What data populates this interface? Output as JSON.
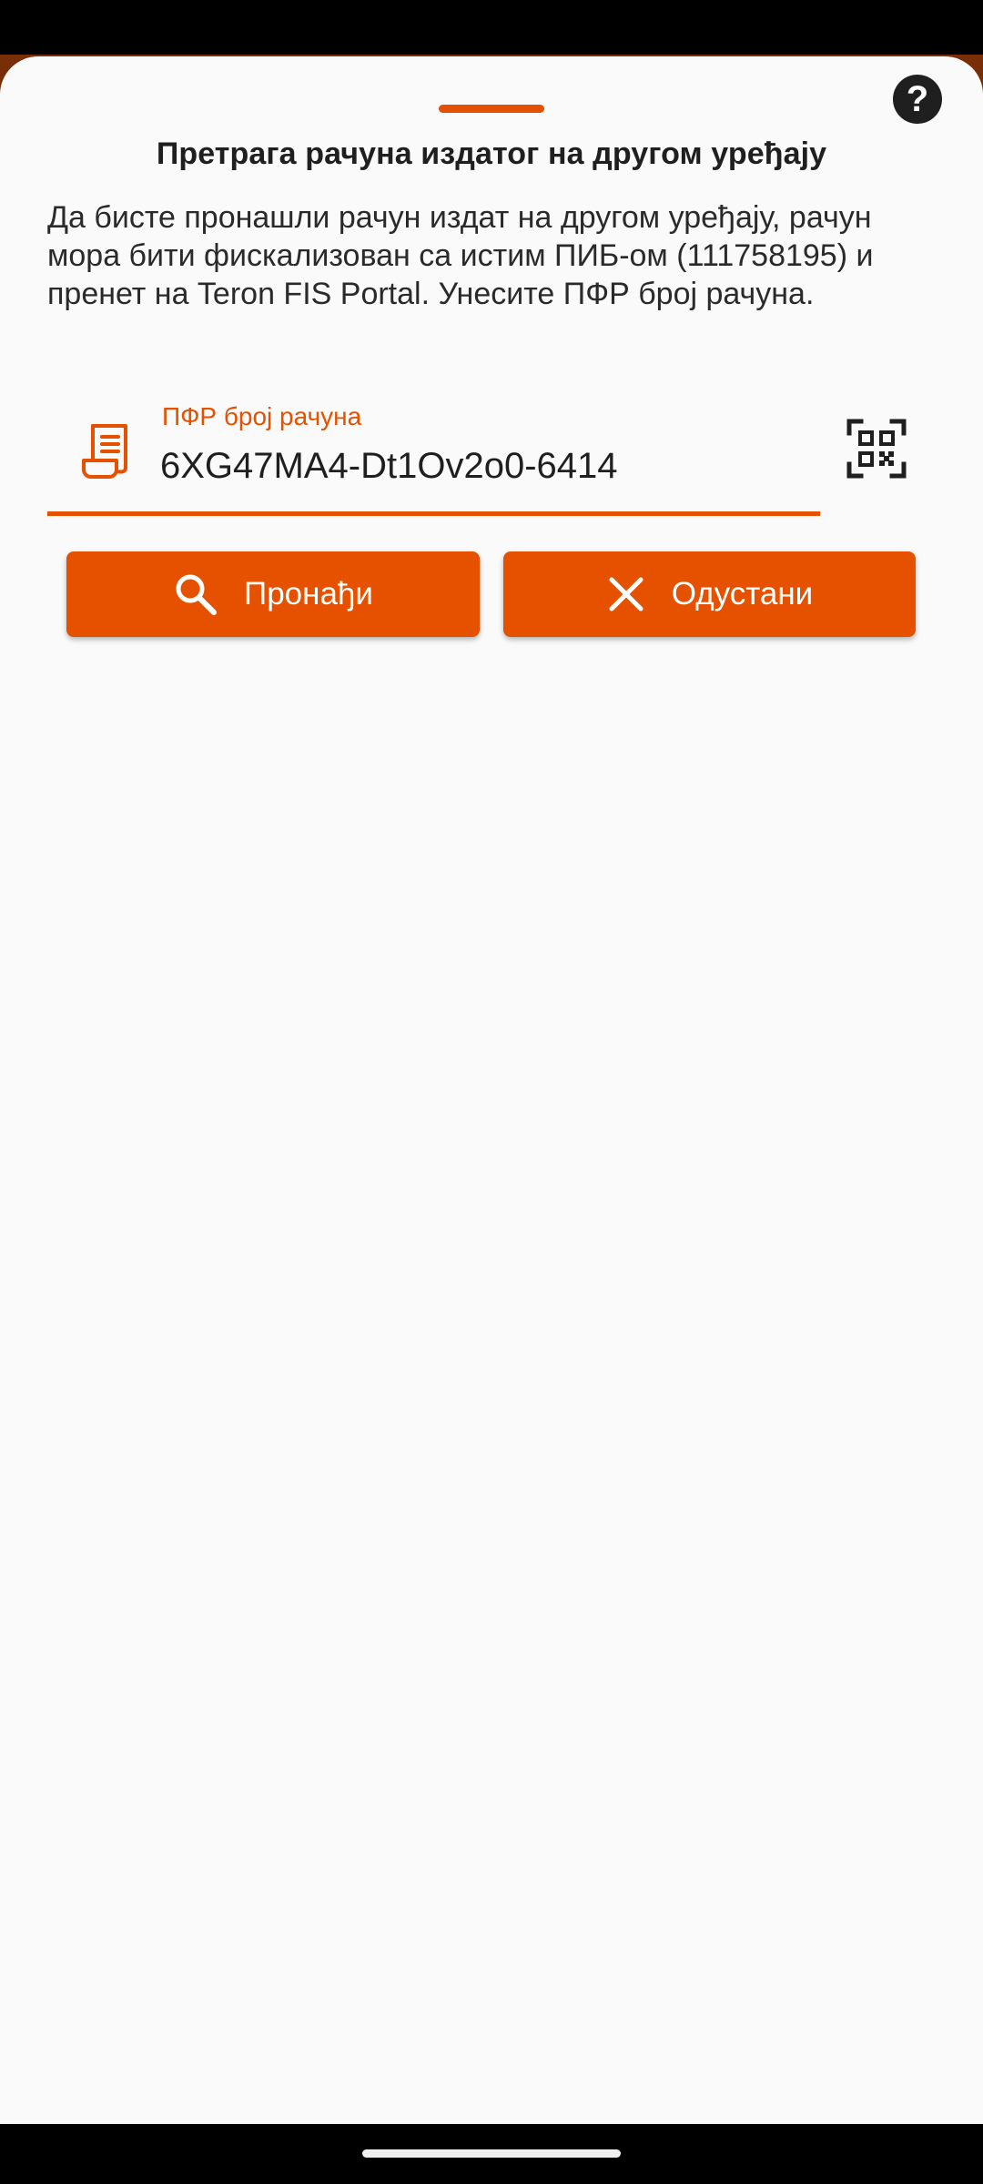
{
  "colors": {
    "accent": "#e65100",
    "sheet_background": "#fafafa",
    "text_primary": "#1f1f1f"
  },
  "dialog": {
    "help_icon": "help-circle-icon",
    "help_symbol": "?",
    "title": "Претрага рачуна издатог на другом уређају",
    "description": "Да бисте пронашли рачун издат на другом уређају, рачун мора бити фискализован са истим ПИБ-ом (111758195) и пренет на Teron FIS Portal. Унесите ПФР број рачуна."
  },
  "field": {
    "icon": "receipt-icon",
    "label": "ПФР број рачуна",
    "value": "6XG47MA4-Dt1Ov2o0-6414",
    "qr_icon": "qr-code-scan-icon"
  },
  "buttons": {
    "find_label": "Пронађи",
    "find_icon": "search-icon",
    "cancel_label": "Одустани",
    "cancel_icon": "close-icon"
  }
}
